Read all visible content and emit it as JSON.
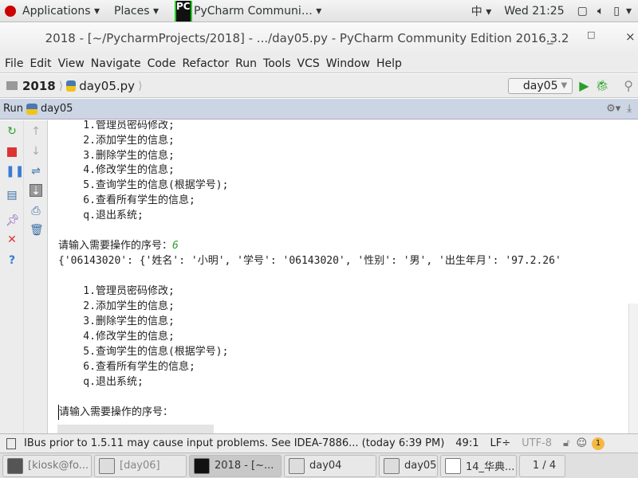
{
  "topbar": {
    "applications": "Applications",
    "places": "Places",
    "active_app": "PyCharm Communi…",
    "input_method": "中",
    "clock": "Wed 21:25"
  },
  "window": {
    "title": "2018 - [~/PycharmProjects/2018] - .../day05.py - PyCharm Community Edition 2016.3.2"
  },
  "menu": [
    "File",
    "Edit",
    "View",
    "Navigate",
    "Code",
    "Refactor",
    "Run",
    "Tools",
    "VCS",
    "Window",
    "Help"
  ],
  "nav": {
    "project": "2018",
    "file": "day05.py",
    "run_config": "day05"
  },
  "run": {
    "label": "Run",
    "config": "day05"
  },
  "console": {
    "lines": [
      "    1.管理员密码修改;",
      "    2.添加学生的信息;",
      "    3.删除学生的信息;",
      "    4.修改学生的信息;",
      "    5.查询学生的信息(根据学号);",
      "    6.查看所有学生的信息;",
      "    q.退出系统;"
    ],
    "prompt": "请输入需要操作的序号：",
    "input": "6",
    "dict_line": "{'06143020': {'姓名': '小明', '学号': '06143020', '性别': '男', '出生年月': '97.2.26'",
    "lines2": [
      "    1.管理员密码修改;",
      "    2.添加学生的信息;",
      "    3.删除学生的信息;",
      "    4.修改学生的信息;",
      "    5.查询学生的信息(根据学号);",
      "    6.查看所有学生的信息;",
      "    q.退出系统;"
    ],
    "prompt2": "请输入需要操作的序号：",
    "input_color": "#2e9e2e"
  },
  "status": {
    "message": "IBus prior to 1.5.11 may cause input problems. See IDEA-7886... (today 6:39 PM)",
    "position": "49:1",
    "line_sep": "LF÷",
    "encoding": "UTF-8",
    "notifications": "1"
  },
  "taskbar": {
    "items": [
      "[kiosk@fo...",
      "[day06]",
      "2018 - [~...",
      "day04",
      "day05",
      "14_华典..."
    ],
    "workspace": "1 / 4"
  }
}
